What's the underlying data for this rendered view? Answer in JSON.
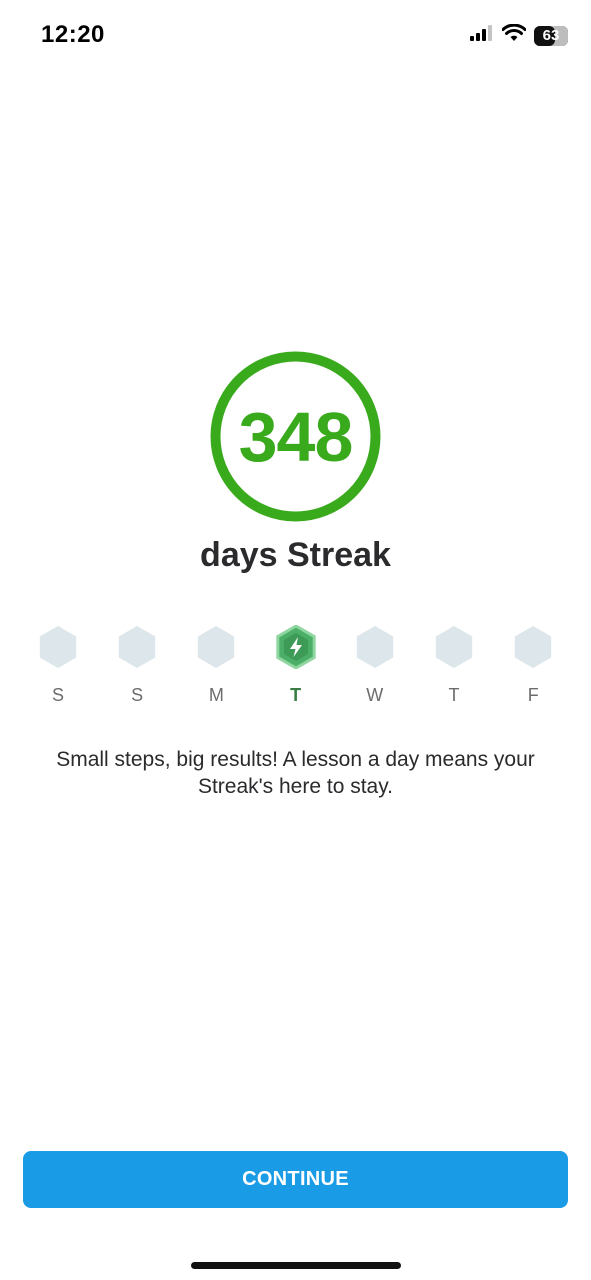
{
  "status_bar": {
    "time": "12:20",
    "battery_percent": "63",
    "battery_level": 0.63,
    "icons": [
      "signal-icon",
      "wifi-icon",
      "battery-icon"
    ]
  },
  "streak": {
    "count": "348",
    "caption": "days Streak",
    "ring_color": "#3aaa1d"
  },
  "week": {
    "days": [
      {
        "label": "S",
        "active": false
      },
      {
        "label": "S",
        "active": false
      },
      {
        "label": "M",
        "active": false
      },
      {
        "label": "T",
        "active": true,
        "icon": "lightning-icon"
      },
      {
        "label": "W",
        "active": false
      },
      {
        "label": "T",
        "active": false
      },
      {
        "label": "F",
        "active": false
      }
    ],
    "inactive_color": "#dde6ea",
    "active_color": "#4caf68"
  },
  "message": "Small steps, big results! A lesson a day means your Streak's here to stay.",
  "continue_button": {
    "label": "CONTINUE",
    "color": "#1a9be6"
  }
}
